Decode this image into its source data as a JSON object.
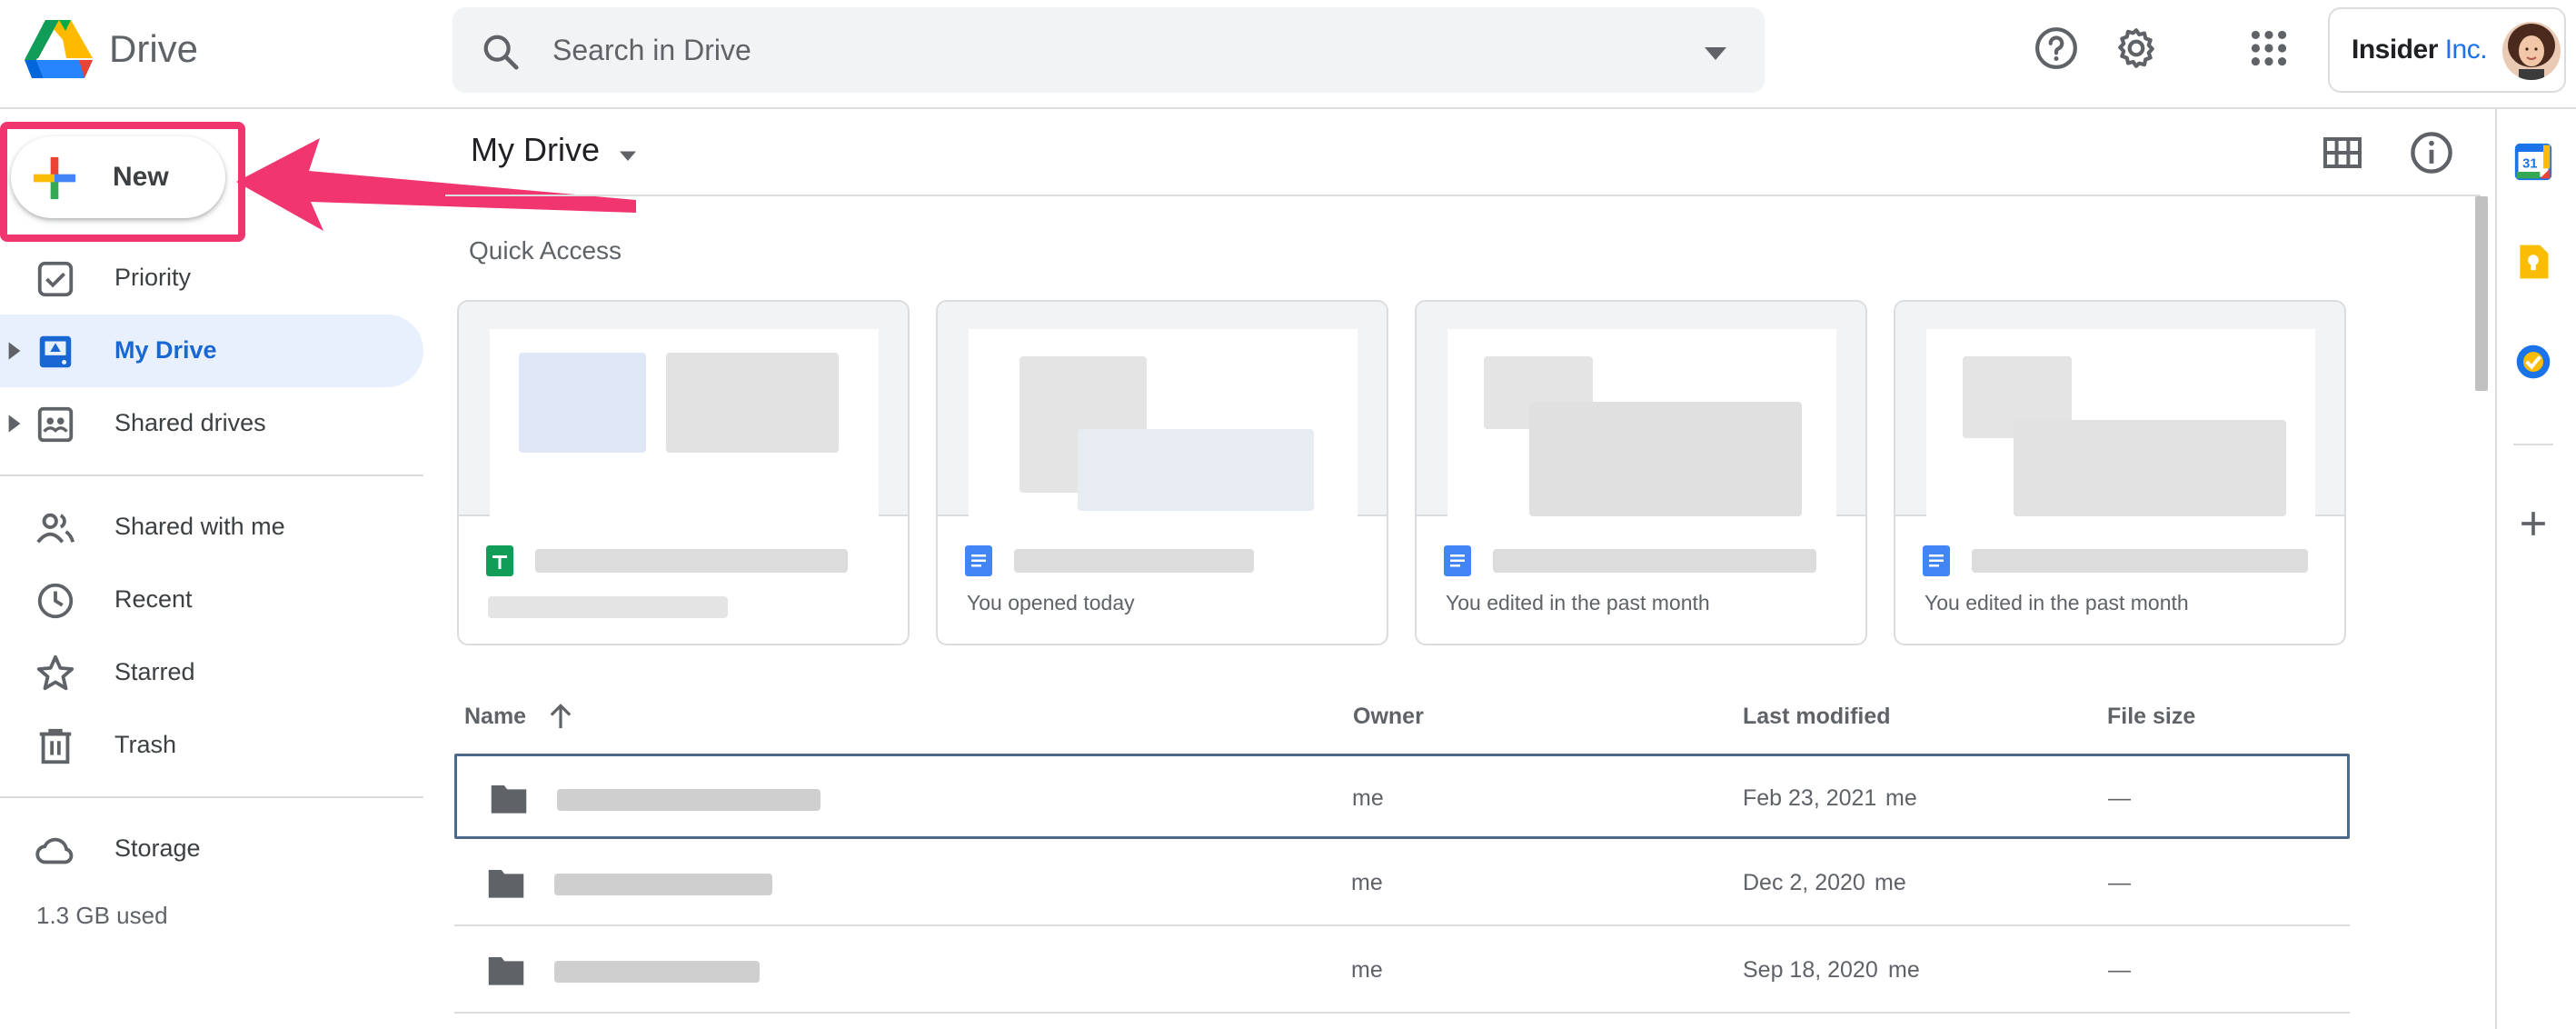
{
  "header": {
    "product_name": "Drive",
    "search_placeholder": "Search in Drive",
    "org_name": "Insider",
    "org_suffix": " Inc."
  },
  "sidebar": {
    "new_label": "New",
    "items": [
      {
        "label": "Priority",
        "icon": "priority-icon"
      },
      {
        "label": "My Drive",
        "icon": "my-drive-icon",
        "active": true
      },
      {
        "label": "Shared drives",
        "icon": "shared-drives-icon"
      },
      {
        "label": "Shared with me",
        "icon": "people-icon"
      },
      {
        "label": "Recent",
        "icon": "clock-icon"
      },
      {
        "label": "Starred",
        "icon": "star-icon"
      },
      {
        "label": "Trash",
        "icon": "trash-icon"
      },
      {
        "label": "Storage",
        "icon": "cloud-icon"
      }
    ],
    "storage_used": "1.3 GB used"
  },
  "main": {
    "location_title": "My Drive",
    "quick_access_label": "Quick Access",
    "quick_access": [
      {
        "type": "sheets",
        "reason": ""
      },
      {
        "type": "docs",
        "reason": "You opened today"
      },
      {
        "type": "docs",
        "reason": "You edited in the past month"
      },
      {
        "type": "docs",
        "reason": "You edited in the past month"
      }
    ],
    "list_headers": {
      "name": "Name",
      "owner": "Owner",
      "last_modified": "Last modified",
      "file_size": "File size"
    },
    "files": [
      {
        "owner": "me",
        "modified": "Feb 23, 2021",
        "modified_by": "me",
        "size": "—"
      },
      {
        "owner": "me",
        "modified": "Dec 2, 2020",
        "modified_by": "me",
        "size": "—"
      },
      {
        "owner": "me",
        "modified": "Sep 18, 2020",
        "modified_by": "me",
        "size": "—"
      }
    ]
  },
  "side_panel": {
    "calendar_day": "31",
    "apps": [
      "calendar-icon",
      "keep-icon",
      "tasks-icon",
      "add-icon"
    ]
  },
  "colors": {
    "accent": "#1a73e8",
    "highlight": "#f0356f",
    "active_nav_bg": "#e8f0fe"
  }
}
